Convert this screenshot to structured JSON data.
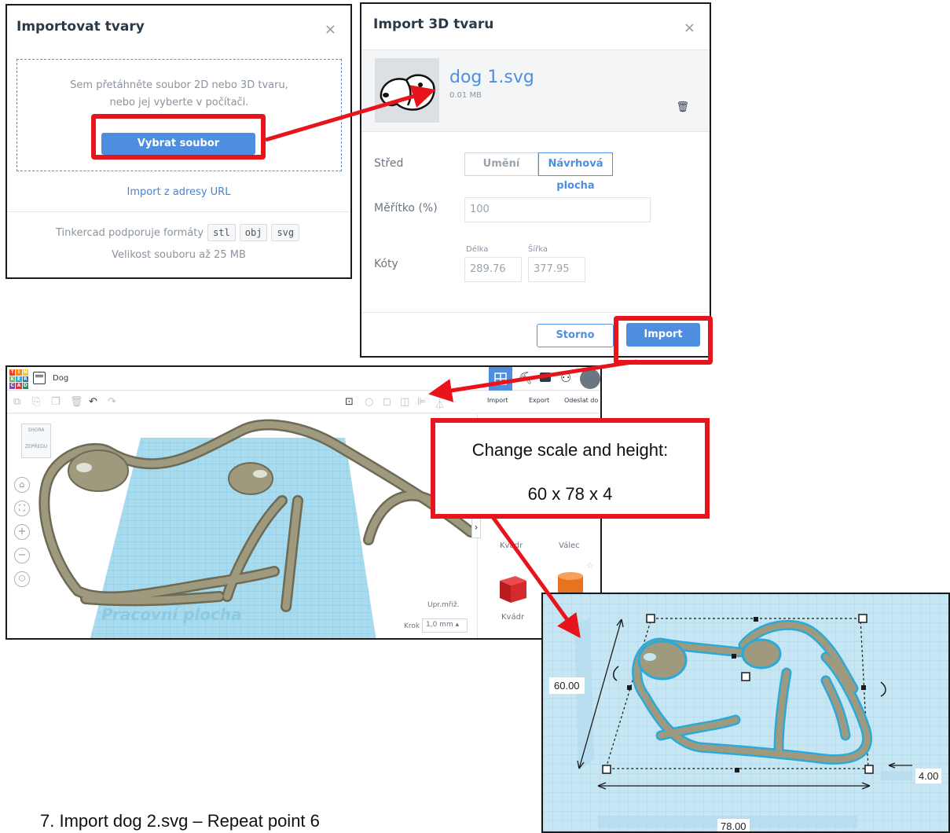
{
  "dialog_import": {
    "title": "Importovat tvary",
    "close": "×",
    "drop_line1": "Sem přetáhněte soubor 2D nebo 3D tvaru,",
    "drop_line2": "nebo jej vyberte v počítači.",
    "choose_file": "Vybrat soubor",
    "url_link": "Import z adresy URL",
    "formats_prefix": "Tinkercad podporuje formáty",
    "formats": [
      "stl",
      "obj",
      "svg"
    ],
    "size_note": "Velikost souboru až 25 MB"
  },
  "dialog_import3d": {
    "title": "Import 3D tvaru",
    "close": "×",
    "file_name": "dog 1.svg",
    "file_size": "0.01 MB",
    "trash_icon": "trash-icon",
    "center_label": "Střed",
    "center_option_art": "Umění",
    "center_option_workplane_line1": "Návrhová",
    "center_option_workplane_line2": "plocha",
    "scale_label": "Měřítko (%)",
    "scale_value": "100",
    "dims_label": "Kóty",
    "length_label": "Délka",
    "width_label": "Šířka",
    "length_value": "289.76",
    "width_value": "377.95",
    "cancel": "Storno",
    "import": "Import"
  },
  "editor": {
    "logo_letters": [
      "T",
      "I",
      "N",
      "K",
      "E",
      "R",
      "C",
      "A",
      "D"
    ],
    "project_name": "Dog",
    "toolbar_import": "Import",
    "toolbar_export": "Export",
    "toolbar_send": "Odeslat do",
    "view_top": "SHORA",
    "view_front": "ZEPŘEDU",
    "workplane_label": "Pracovní plocha",
    "edit_grid": "Upr.mřiž.",
    "snap_label": "Krok",
    "snap_value": "1,0 mm",
    "shape_box_top": "Kvádr",
    "shape_cylinder": "Válec",
    "shape_box": "Kvádr",
    "colors": {
      "box": "#d42a2a",
      "cylinder": "#e8731c",
      "shape": "#9f9a7e",
      "grid": "#a9dbef"
    }
  },
  "callout": {
    "line1": "Change scale and height:",
    "line2": "60 x 78 x 4"
  },
  "zoom": {
    "dim_height": "60.00",
    "dim_width": "78.00",
    "dim_thickness": "4.00"
  },
  "caption": "7.    Import dog 2.svg – Repeat point 6"
}
